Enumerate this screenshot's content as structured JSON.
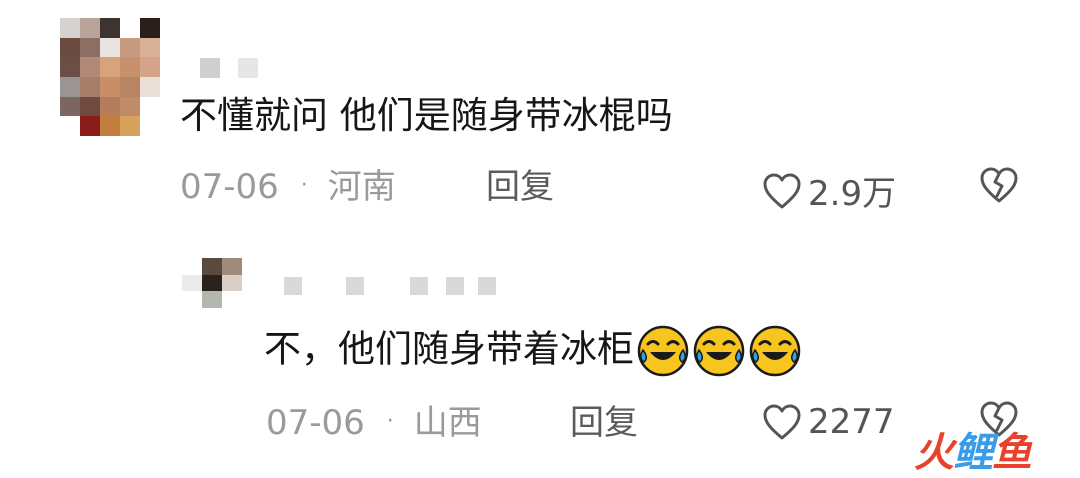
{
  "comments": [
    {
      "text": "不懂就问 他们是随身带冰棍吗",
      "date": "07-06",
      "separator": "·",
      "location": "河南",
      "reply_label": "回复",
      "likes": "2.9万"
    },
    {
      "text": "不，他们随身带着冰柜",
      "date": "07-06",
      "separator": "·",
      "location": "山西",
      "reply_label": "回复",
      "likes": "2277",
      "emoji_count": 3
    }
  ],
  "icons": [
    "heart-icon",
    "broken-heart-icon",
    "laughing-crying-emoji"
  ],
  "watermark": {
    "text": "火鲤鱼",
    "colors": [
      "#e8412c",
      "#3a9be8",
      "#e8412c"
    ]
  },
  "colors": {
    "text_primary": "#161616",
    "text_meta": "#9a9a9a",
    "reply": "#5b5b5b"
  }
}
